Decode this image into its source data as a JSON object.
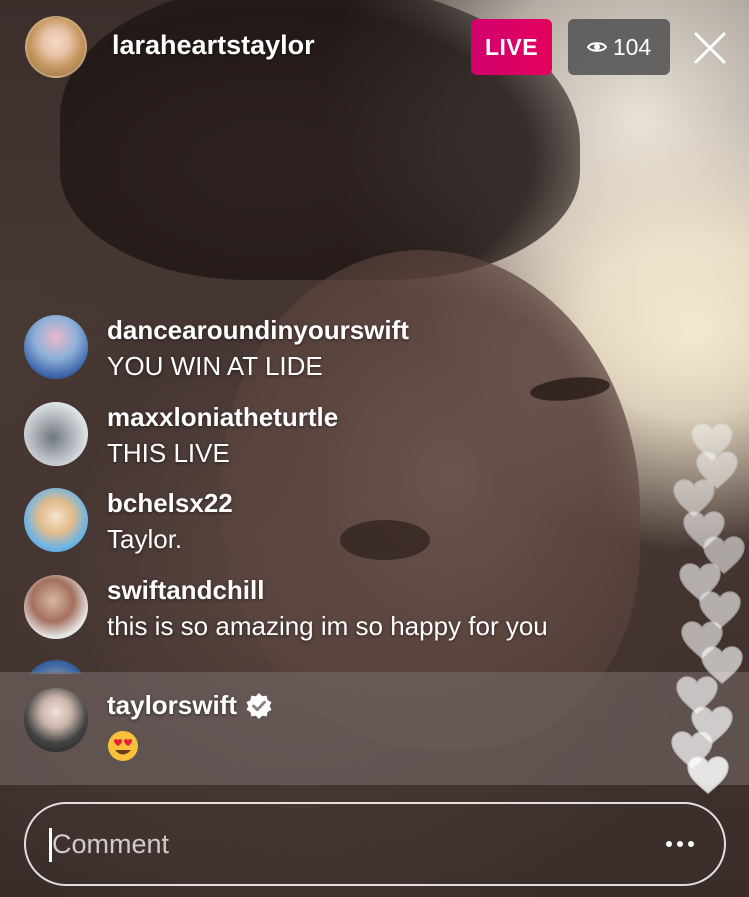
{
  "header": {
    "host_username": "laraheartstaylor",
    "live_label": "LIVE",
    "viewer_count": "104"
  },
  "comments": [
    {
      "username": "dancearoundinyourswift",
      "text": "YOU WIN AT LIDE"
    },
    {
      "username": "maxxloniatheturtle",
      "text": "THIS LIVE"
    },
    {
      "username": "bchelsx22",
      "text": "Taylor."
    },
    {
      "username": "swiftandchill",
      "text": "this is so amazing im so happy for you"
    }
  ],
  "pinned_comment": {
    "username": "taylorswift",
    "verified": true,
    "emoji": "heart-eyes-emoji"
  },
  "comment_input": {
    "placeholder": "Comment"
  },
  "icons": {
    "viewers": "eye-icon",
    "close": "close-icon",
    "more": "more-options-icon",
    "hearts": "heart-icon",
    "verified": "verified-badge-icon"
  },
  "colors": {
    "live_badge": "#d6006a",
    "viewer_badge": "#505050",
    "verified_badge": "#ffffff"
  }
}
